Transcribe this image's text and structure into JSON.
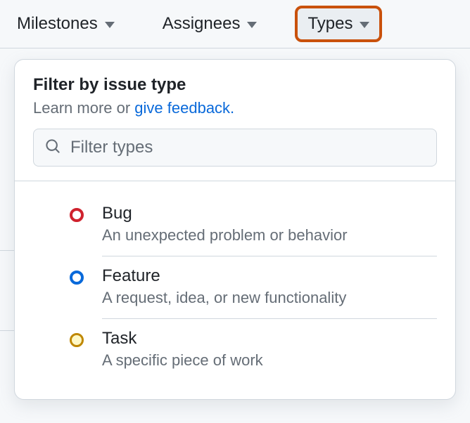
{
  "filters": {
    "milestones": "Milestones",
    "assignees": "Assignees",
    "types": "Types"
  },
  "panel": {
    "title": "Filter by issue type",
    "subtitle_prefix": "Learn more or ",
    "subtitle_link": "give feedback.",
    "search_placeholder": "Filter types"
  },
  "types": [
    {
      "name": "Bug",
      "desc": "An unexpected problem or behavior",
      "color": "red"
    },
    {
      "name": "Feature",
      "desc": "A request, idea, or new functionality",
      "color": "blue"
    },
    {
      "name": "Task",
      "desc": "A specific piece of work",
      "color": "yellow"
    }
  ]
}
